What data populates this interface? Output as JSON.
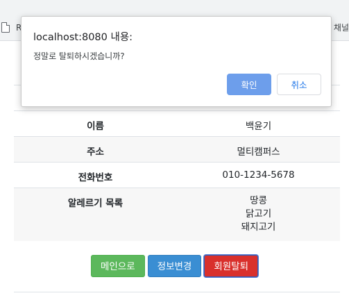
{
  "browser": {
    "bookmark_left": "R",
    "bookmark_right": "채널"
  },
  "dialog": {
    "title": "localhost:8080 내용:",
    "message": "정말로 탈퇴하시겠습니까?",
    "ok_label": "확인",
    "cancel_label": "취소"
  },
  "table": {
    "rows": [
      {
        "key": "이름",
        "value": "백윤기"
      },
      {
        "key": "주소",
        "value": "멀티캠퍼스"
      },
      {
        "key": "전화번호",
        "value": "010-1234-5678"
      },
      {
        "key": "알레르기 목록",
        "values": [
          "땅콩",
          "닭고기",
          "돼지고기"
        ]
      }
    ]
  },
  "buttons": {
    "main_label": "메인으로",
    "edit_label": "정보변경",
    "withdraw_label": "회원탈퇴"
  },
  "colors": {
    "green_button": "#5cb85c",
    "blue_button": "#3a8ed3",
    "red_button": "#d9302c",
    "dialog_ok": "#6d9eeb",
    "dialog_cancel_text": "#1a73e8"
  }
}
